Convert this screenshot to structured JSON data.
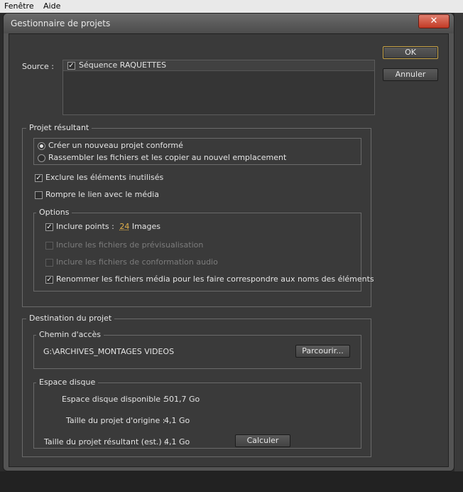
{
  "menubar": {
    "items": [
      "Fenêtre",
      "Aide"
    ]
  },
  "dialog": {
    "title": "Gestionnaire de projets",
    "close_glyph": "✕",
    "source": {
      "label": "Source :",
      "items": [
        {
          "label": "Séquence RAQUETTES",
          "checked": true
        }
      ]
    },
    "buttons": {
      "ok": "OK",
      "cancel": "Annuler"
    },
    "projet_resultant": {
      "legend": "Projet résultant",
      "radio_options": [
        {
          "label": "Créer un nouveau projet conformé",
          "selected": true
        },
        {
          "label": "Rassembler les fichiers et les copier au nouvel emplacement",
          "selected": false
        }
      ],
      "exclure": {
        "label": "Exclure les éléments inutilisés",
        "checked": true
      },
      "rompre": {
        "label": "Rompre le lien avec le média",
        "checked": false
      },
      "options": {
        "legend": "Options",
        "inclure_points": {
          "label": "Inclure points :",
          "value": "24",
          "unit": "Images",
          "checked": true
        },
        "previsualisation": {
          "label": "Inclure les fichiers de prévisualisation",
          "checked": false,
          "enabled": false
        },
        "conformation": {
          "label": "Inclure les fichiers de conformation audio",
          "checked": false,
          "enabled": false
        },
        "renommer": {
          "label": "Renommer les fichiers média pour les faire correspondre aux noms des éléments",
          "checked": true
        }
      }
    },
    "destination": {
      "legend": "Destination du projet",
      "chemin": {
        "legend": "Chemin d'accès",
        "path": "G:\\ARCHIVES_MONTAGES VIDEOS",
        "browse": "Parcourir..."
      },
      "espace": {
        "legend": "Espace disque",
        "disponible": {
          "label": "Espace disque disponible :",
          "value": "501,7 Go"
        },
        "origine": {
          "label": "Taille du projet d'origine :",
          "value": "4,1 Go"
        },
        "resultant": {
          "label": "Taille du projet résultant (est.) :",
          "value": "4,1 Go"
        },
        "calculer": "Calculer"
      }
    }
  }
}
